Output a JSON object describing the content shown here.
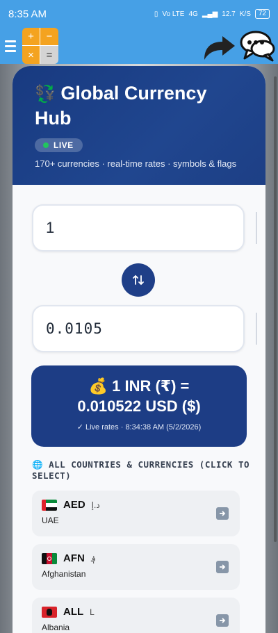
{
  "status_bar": {
    "time": "8:35 AM",
    "network_label": "Vo LTE",
    "network_type": "4G",
    "speed": "12.7",
    "speed_unit": "K/S",
    "battery": "72"
  },
  "toolbar": {
    "calc_plus": "+",
    "calc_minus": "−",
    "calc_times": "×",
    "calc_equals": "="
  },
  "hero": {
    "emoji": "💱",
    "title": "Global Currency Hub",
    "live_badge": "LIVE",
    "subtitle": "170+ currencies · real-time rates · symbols & flags"
  },
  "converter": {
    "amount_value": "1",
    "result_value": "0.0105",
    "rate_emoji": "💰",
    "rate_line1": "1 INR (₹) =",
    "rate_line2": "0.010522 USD ($)",
    "rate_note": "✓ Live rates · 8:34:38 AM (5/2/2026)"
  },
  "section": {
    "emoji": "🌐",
    "title": "ALL COUNTRIES & CURRENCIES (CLICK TO SELECT)"
  },
  "countries": [
    {
      "code": "AED",
      "symbol": "د.إ",
      "name": "UAE"
    },
    {
      "code": "AFN",
      "symbol": "؋",
      "name": "Afghanistan"
    },
    {
      "code": "ALL",
      "symbol": "L",
      "name": "Albania"
    }
  ],
  "colors": {
    "header_blue": "#46a0e6",
    "hero_navy": "#1d3f85",
    "live_green": "#22c55e",
    "calc_orange": "#f4a320"
  }
}
